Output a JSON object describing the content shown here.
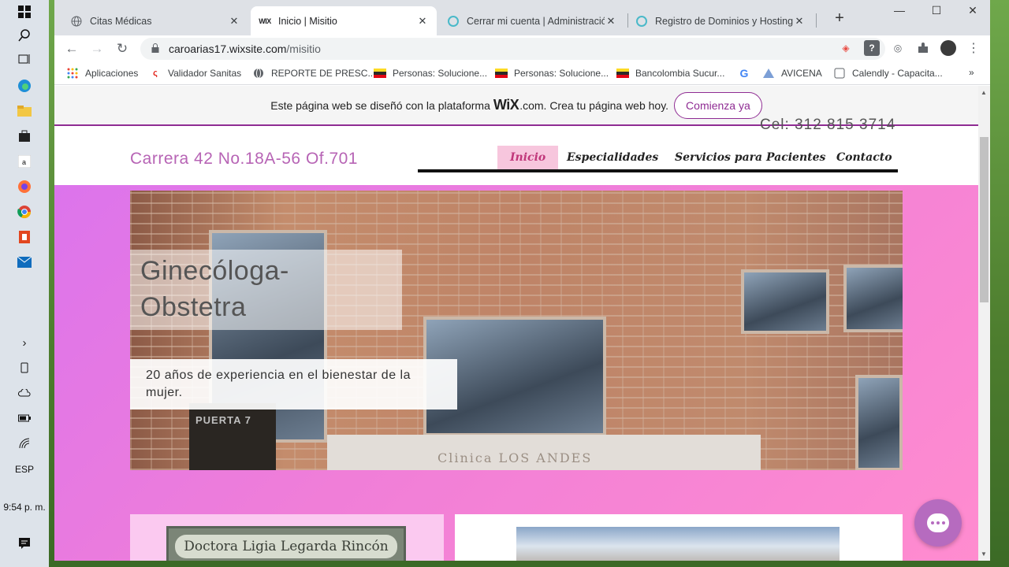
{
  "taskbar": {
    "language": "ESP",
    "time": "9:54 p. m."
  },
  "window_controls": {
    "minimize": "—",
    "maximize": "☐",
    "close": "✕"
  },
  "tabs": [
    {
      "title": "Citas Médicas",
      "favicon": "globe-icon"
    },
    {
      "title": "Inicio | Misitio",
      "favicon": "WIX"
    },
    {
      "title": "Cerrar mi cuenta | Administración",
      "favicon": "swirl-icon"
    },
    {
      "title": "Registro de Dominios y Hosting",
      "favicon": "swirl-icon"
    }
  ],
  "new_tab": "+",
  "omnibox": {
    "host": "caroarias17.wixsite.com",
    "path": "/misitio"
  },
  "bookmarks": [
    {
      "label": "Aplicaciones",
      "icon": "apps-grid-icon"
    },
    {
      "label": "Validador Sanitas",
      "icon": "sanitas-icon"
    },
    {
      "label": "REPORTE DE PRESC...",
      "icon": "globe-icon"
    },
    {
      "label": "Personas: Solucione...",
      "icon": "bancolombia-icon"
    },
    {
      "label": "Personas: Solucione...",
      "icon": "bancolombia-icon"
    },
    {
      "label": "Bancolombia Sucur...",
      "icon": "bancolombia-icon"
    },
    {
      "label": "",
      "icon": "google-icon"
    },
    {
      "label": "AVICENA",
      "icon": "avicena-icon"
    },
    {
      "label": "Calendly - Capacita...",
      "icon": "calendly-icon"
    }
  ],
  "bookmarks_more": "»",
  "wix_banner": {
    "text_before": "Este página web se diseñó con la plataforma",
    "brand": "WiX",
    "text_after": ".com. Crea tu página web hoy.",
    "cta": "Comienza ya"
  },
  "site": {
    "phone": "Cel: 312 815 3714",
    "address": "Carrera 42 No.18A-56 Of.701",
    "nav": [
      "Inicio",
      "Especialidades",
      "Servicios para Pacientes",
      "Contacto"
    ],
    "hero_title": "Ginecóloga-Obstetra",
    "hero_title_line1": "Ginecóloga-",
    "hero_title_line2": "Obstetra",
    "hero_subtitle": "20 años de experiencia en el bienestar de la mujer.",
    "hero_plinth": "Clinica LOS ANDES",
    "hero_door": "PUERTA 7",
    "nameplate": "Doctora Ligia Legarda Rincón"
  },
  "colors": {
    "wix_purple": "#8f2c93",
    "address_pink": "#b764b5",
    "nav_active_bg": "#f7c6dd",
    "nav_active_text": "#c0377a",
    "chat_bubble": "#b66bbf"
  }
}
